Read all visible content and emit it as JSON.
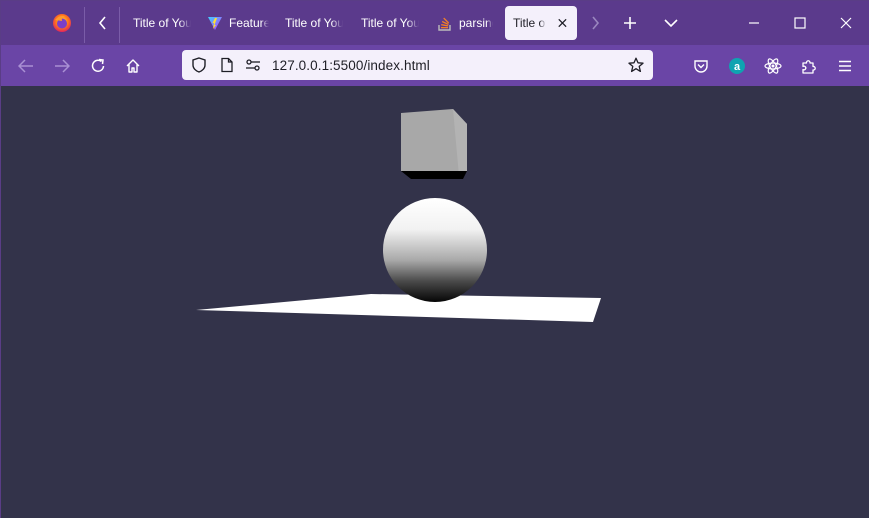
{
  "window": {
    "accent": "#5b3a8c",
    "navbar_color": "#6a45a6",
    "canvas_bg": "#33334a"
  },
  "tabs": [
    {
      "label": "Title of Your",
      "icon": "none"
    },
    {
      "label": "Feature",
      "icon": "vite-icon"
    },
    {
      "label": "Title of Your",
      "icon": "none"
    },
    {
      "label": "Title of Your",
      "icon": "none"
    },
    {
      "label": "parsing",
      "icon": "stackoverflow-icon"
    },
    {
      "label": "Title of Y",
      "icon": "none",
      "active": true
    }
  ],
  "address": {
    "url": "127.0.0.1:5500/index.html"
  },
  "scene": {
    "objects": [
      "cube",
      "sphere",
      "plane"
    ]
  }
}
